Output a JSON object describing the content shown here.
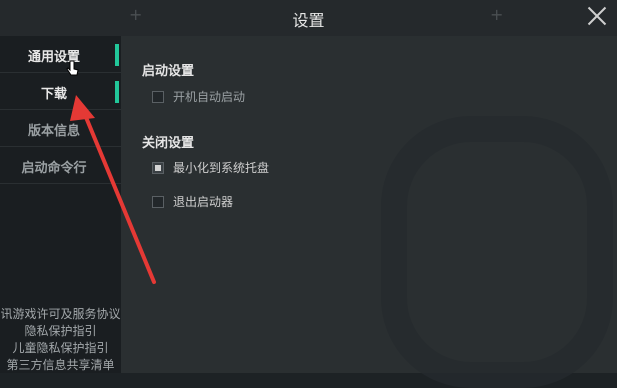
{
  "window": {
    "title": "设置"
  },
  "sidebar": {
    "items": [
      {
        "label": "通用设置"
      },
      {
        "label": "下载"
      },
      {
        "label": "版本信息"
      },
      {
        "label": "启动命令行"
      }
    ],
    "links": [
      "讯游戏许可及服务协议",
      "隐私保护指引",
      "儿童隐私保护指引",
      "第三方信息共享清单"
    ]
  },
  "main": {
    "startup": {
      "title": "启动设置",
      "options": [
        {
          "label": "开机自动启动",
          "checked": false
        }
      ]
    },
    "close": {
      "title": "关闭设置",
      "options": [
        {
          "label": "最小化到系统托盘",
          "checked": true
        },
        {
          "label": "退出启动器",
          "checked": false
        }
      ]
    }
  },
  "colors": {
    "accent": "#22c79a",
    "annotation_arrow": "#e53935"
  }
}
